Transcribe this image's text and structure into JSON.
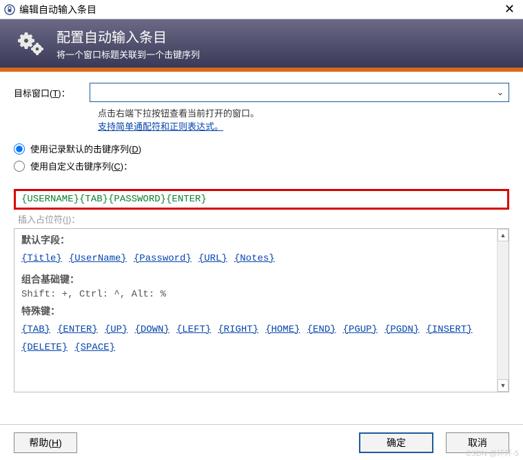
{
  "titlebar": {
    "title": "编辑自动输入条目"
  },
  "header": {
    "title": "配置自动输入条目",
    "subtitle": "将一个窗口标题关联到一个击键序列"
  },
  "target": {
    "label_pre": "目标窗口(",
    "label_hotkey": "T",
    "label_post": ")：",
    "value": "",
    "hint": "点击右端下拉按钮查看当前打开的窗口。",
    "link": "支持简单通配符和正则表达式。"
  },
  "radios": {
    "default_pre": "使用记录默认的击键序列(",
    "default_hotkey": "D",
    "default_post": ")",
    "custom_pre": "使用自定义击键序列(",
    "custom_hotkey": "C",
    "custom_post": ")："
  },
  "sequence": "{USERNAME}{TAB}{PASSWORD}{ENTER}",
  "insert_label_pre": "插入占位符(",
  "insert_label_hotkey": "I",
  "insert_label_post": ")：",
  "placeholders": {
    "default_fields": {
      "title": "默认字段：",
      "items": [
        "{Title}",
        "{UserName}",
        "{Password}",
        "{URL}",
        "{Notes}"
      ]
    },
    "combo_keys": {
      "title": "组合基础键：",
      "desc": "Shift: +, Ctrl: ^, Alt: %"
    },
    "special_keys": {
      "title": "特殊键：",
      "items": [
        "{TAB}",
        "{ENTER}",
        "{UP}",
        "{DOWN}",
        "{LEFT}",
        "{RIGHT}",
        "{HOME}",
        "{END}",
        "{PGUP}",
        "{PGDN}",
        "{INSERT}",
        "{DELETE}",
        "{SPACE}"
      ]
    }
  },
  "buttons": {
    "help_pre": "帮助(",
    "help_hotkey": "H",
    "help_post": ")",
    "ok": "确定",
    "cancel": "取消"
  },
  "watermark": "CSDN @环环-5"
}
